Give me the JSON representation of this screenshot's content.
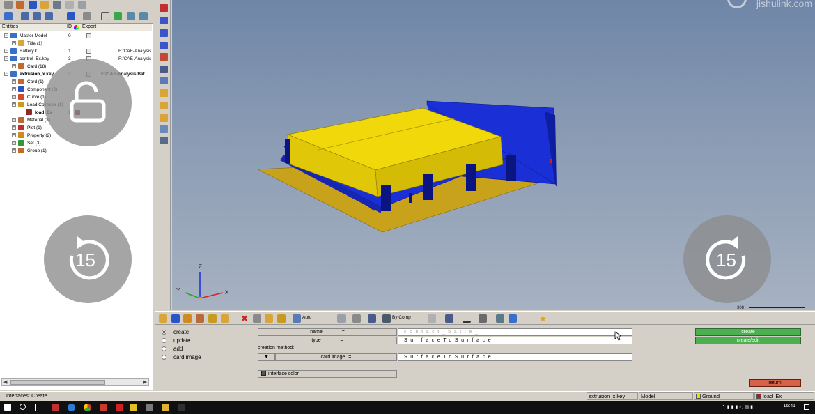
{
  "tree": {
    "headers": {
      "entities": "Entities",
      "id": "ID",
      "export": "Export"
    },
    "rows": [
      {
        "label": "Master Model",
        "id": "0",
        "export": true,
        "path": "",
        "level": 0,
        "icon": "model-icon",
        "color": "#3a6fc9",
        "bold": false
      },
      {
        "label": "Title (1)",
        "id": "",
        "export": false,
        "path": "",
        "level": 1,
        "icon": "title-icon",
        "color": "#d9a43a",
        "bold": false
      },
      {
        "label": "Battery.k",
        "id": "1",
        "export": true,
        "path": "F:/CAE-Analysis",
        "level": 0,
        "icon": "model-icon",
        "color": "#3a6fc9",
        "bold": false
      },
      {
        "label": "control_Ex.key",
        "id": "3",
        "export": true,
        "path": "F:/CAE-Analysis",
        "level": 0,
        "icon": "model-icon",
        "color": "#3a6fc9",
        "bold": false
      },
      {
        "label": "Card (18)",
        "id": "",
        "export": false,
        "path": "",
        "level": 1,
        "icon": "card-icon",
        "color": "#c26a2e",
        "bold": false
      },
      {
        "label": "extrusion_x.key",
        "id": "2",
        "export": true,
        "path": "F:/CAE-Analysis/Bat",
        "level": 0,
        "icon": "model-icon",
        "color": "#3a6fc9",
        "bold": true
      },
      {
        "label": "Card (1)",
        "id": "",
        "export": false,
        "path": "",
        "level": 1,
        "icon": "card-icon",
        "color": "#c26a2e",
        "bold": false
      },
      {
        "label": "Component (2)",
        "id": "",
        "export": false,
        "path": "",
        "level": 1,
        "icon": "component-icon",
        "color": "#2a55c8",
        "bold": false
      },
      {
        "label": "Curve (1)",
        "id": "",
        "export": false,
        "path": "",
        "level": 1,
        "icon": "curve-icon",
        "color": "#d54a2a",
        "bold": false
      },
      {
        "label": "Load Collector (1)",
        "id": "",
        "export": false,
        "path": "",
        "level": 1,
        "icon": "load-collector-icon",
        "color": "#c89a20",
        "bold": false
      },
      {
        "label": "load_Ex",
        "id": "1",
        "export": false,
        "path": "",
        "level": 2,
        "icon": "load-icon",
        "color": "#8a2a2a",
        "bold": true
      },
      {
        "label": "Material (3)",
        "id": "",
        "export": false,
        "path": "",
        "level": 1,
        "icon": "material-icon",
        "color": "#b86a3a",
        "bold": false
      },
      {
        "label": "Plot (1)",
        "id": "",
        "export": false,
        "path": "",
        "level": 1,
        "icon": "plot-icon",
        "color": "#c03030",
        "bold": false
      },
      {
        "label": "Property (2)",
        "id": "",
        "export": false,
        "path": "",
        "level": 1,
        "icon": "property-icon",
        "color": "#d08a20",
        "bold": false
      },
      {
        "label": "Set (3)",
        "id": "",
        "export": false,
        "path": "",
        "level": 1,
        "icon": "set-icon",
        "color": "#2e9a3a",
        "bold": false
      },
      {
        "label": "Group (1)",
        "id": "",
        "export": false,
        "path": "",
        "level": 1,
        "icon": "group-icon",
        "color": "#c26a2e",
        "bold": false
      }
    ]
  },
  "viewport": {
    "watermark": "jishulink.com",
    "scale_label": "308",
    "axis": {
      "x": "X",
      "y": "Y",
      "z": "Z"
    },
    "colors": {
      "yellow": "#f0d80a",
      "blue": "#1a2fd6",
      "plate": "#c8a21a"
    }
  },
  "overlay": {
    "lock_icon": "unlock-icon",
    "rewind_label": "15",
    "forward_label": "15"
  },
  "bottom_toolbar": {
    "auto_label": "Auto",
    "by_comp_label": "By Comp"
  },
  "form": {
    "radios": [
      {
        "label": "create",
        "selected": true
      },
      {
        "label": "update",
        "selected": false
      },
      {
        "label": "add",
        "selected": false
      },
      {
        "label": "card image",
        "selected": false
      }
    ],
    "name_label": "name",
    "name_eq": "=",
    "name_value": "contact_batte_",
    "type_label": "type",
    "type_eq": "=",
    "type_value": "SurfaceToSurface",
    "creation_method_label": "creation method:",
    "card_image_label": "card image",
    "card_image_eq": "=",
    "card_image_value": "SurfaceToSurface",
    "interface_color_label": "interface color",
    "create_button": "create",
    "create_edit_button": "create/edit",
    "return_button": "return"
  },
  "status_bar": {
    "mode": "Interfaces: Create",
    "include": "extrusion_x.key",
    "model": "Model",
    "component": "Ground",
    "load_collector": "load_Ex",
    "component_color": "#f0d80a",
    "load_collector_color": "#8a2a2a"
  },
  "taskbar": {
    "time": "16:41"
  }
}
